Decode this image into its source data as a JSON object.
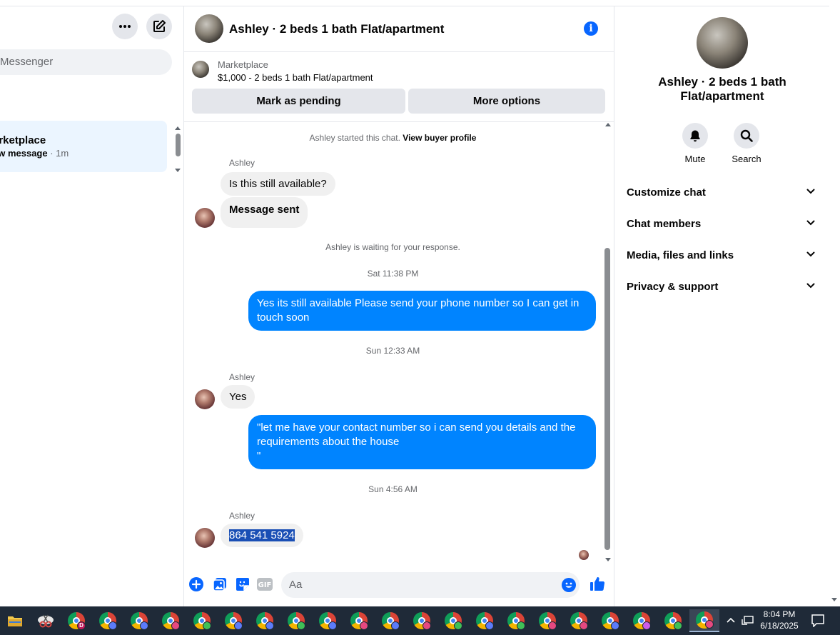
{
  "sidebar": {
    "search_placeholder": "Messenger",
    "conversation": {
      "title": "arketplace",
      "status": "ew message",
      "time": "· 1m"
    }
  },
  "chat": {
    "header_title": "Ashley · 2 beds 1 bath Flat/apartment",
    "marketplace": {
      "label": "Marketplace",
      "listing": "$1,000 - 2 beds 1 bath Flat/apartment",
      "pending_button": "Mark as pending",
      "options_button": "More options"
    },
    "started_text": "Ashley started this chat.",
    "view_profile_link": "View buyer profile",
    "waiting_text": "Ashley is waiting for your response.",
    "messages": [
      {
        "sender": "Ashley",
        "text": "Is this still available?"
      },
      {
        "text": "Message sent"
      },
      {
        "timestamp": "Sat 11:38 PM"
      },
      {
        "text": "Yes its still available Please send your phone number so I can get in touch soon"
      },
      {
        "timestamp": "Sun 12:33 AM"
      },
      {
        "sender": "Ashley",
        "text": "Yes"
      },
      {
        "text": "\"let me have your contact number so i can send you details and the requirements about the house\n\""
      },
      {
        "timestamp": "Sun 4:56 AM"
      },
      {
        "sender": "Ashley",
        "text": "864 541 5924"
      }
    ],
    "composer_placeholder": "Aa",
    "gif_label": "GIF"
  },
  "right_panel": {
    "title": "Ashley · 2 beds 1 bath Flat/apartment",
    "mute_label": "Mute",
    "search_label": "Search",
    "sections": [
      "Customize chat",
      "Chat members",
      "Media, files and links",
      "Privacy & support"
    ]
  },
  "taskbar": {
    "time": "8:04 PM",
    "date": "6/18/2025",
    "profile_badges": [
      "D",
      "",
      "",
      "",
      "",
      "",
      "",
      "",
      "",
      "",
      "",
      "",
      "",
      "",
      "",
      "",
      "",
      "",
      "",
      ""
    ],
    "badge_colors": [
      "#c2185b",
      "#5c7cfa",
      "#5c7cfa",
      "#e64980",
      "#40c057",
      "#5c7cfa",
      "#5c7cfa",
      "#40c057",
      "#5c7cfa",
      "#e64980",
      "#5c7cfa",
      "#e64980",
      "#40c057",
      "#5c7cfa",
      "#40c057",
      "#e64980",
      "#e64980",
      "#5c7cfa",
      "#cc5de8",
      "#40c057",
      "#e64980"
    ]
  },
  "colors": {
    "accent": "#0866ff",
    "outgoing_bubble": "#0084ff",
    "incoming_bubble": "#f0f0f0"
  }
}
